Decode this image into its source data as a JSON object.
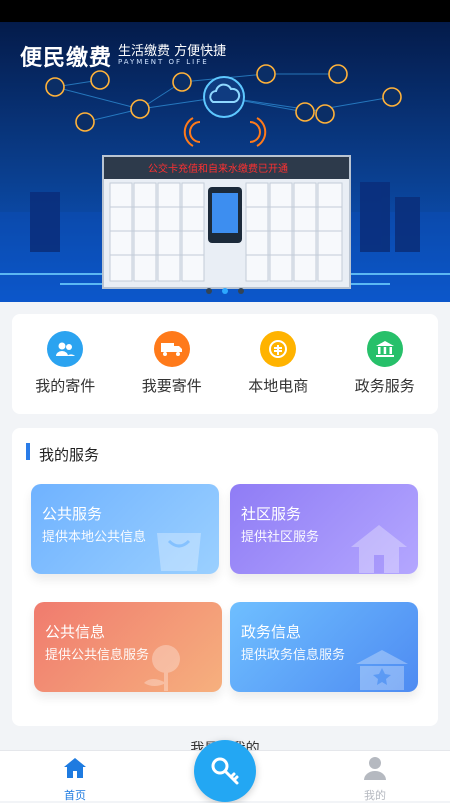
{
  "banner": {
    "title": "便民缴费",
    "subtitle": "生活缴费 方便快捷",
    "subtitle_en": "PAYMENT OF LIFE",
    "ticker": "公交卡充值和自来水缴费已开通",
    "slide_index": 1,
    "slide_count": 3
  },
  "quick_actions": [
    {
      "label": "我的寄件",
      "icon": "people-icon",
      "color": "#2ba3f0"
    },
    {
      "label": "我要寄件",
      "icon": "truck-icon",
      "color": "#ff7a1a"
    },
    {
      "label": "本地电商",
      "icon": "shop-icon",
      "color": "#ffb300"
    },
    {
      "label": "政务服务",
      "icon": "government-icon",
      "color": "#27c06a"
    }
  ],
  "services": {
    "title": "我的服务",
    "cards": [
      {
        "title": "公共服务",
        "desc": "提供本地公共信息",
        "icon": "bag-icon"
      },
      {
        "title": "社区服务",
        "desc": "提供社区服务",
        "icon": "house-icon"
      },
      {
        "title": "公共信息",
        "desc": "提供公共信息服务",
        "icon": "flower-icon"
      },
      {
        "title": "政务信息",
        "desc": "提供政务信息服务",
        "icon": "building-icon"
      }
    ]
  },
  "partial_text": "我是...我的",
  "tabbar": {
    "home": "首页",
    "mine": "我的",
    "center_icon": "key-icon",
    "active_color": "#1e7be0",
    "inactive_color": "#b5b9c0"
  }
}
